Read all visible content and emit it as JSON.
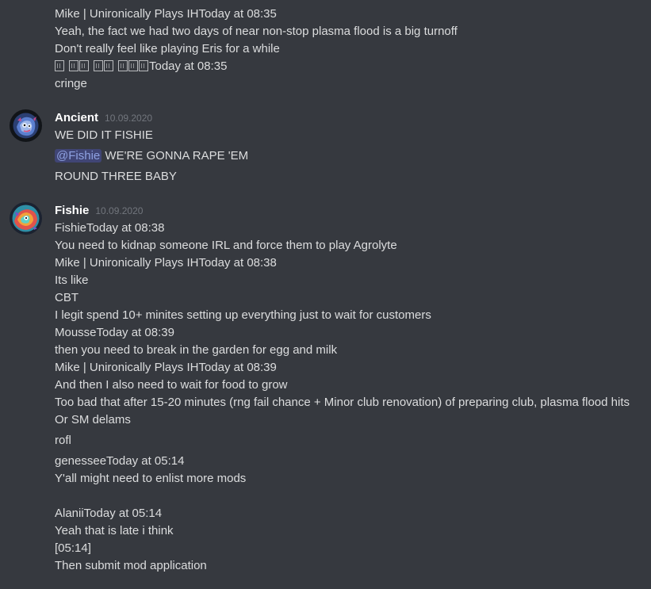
{
  "colors": {
    "background": "#36393f",
    "text": "#dcddde",
    "author": "#ffffff",
    "timestamp": "#72767d",
    "mention": "#8ea1e1"
  },
  "block1": {
    "lines": [
      "Mike | Unironically Plays IHToday at 08:35",
      "Yeah, the fact we had two days of near non-stop plasma flood is a big turnoff",
      "Don't really feel like playing Eris for a while",
      "Today at 08:35",
      "cringe"
    ]
  },
  "ancient": {
    "author": "Ancient",
    "timestamp": "10.09.2020",
    "avatar_icon": "ancient-avatar-icon",
    "line1": "WE DID IT FISHIE",
    "mention": "@Fishie",
    "line2_rest": " WE'RE GONNA RAPE 'EM",
    "line3": "ROUND THREE BABY"
  },
  "fishie": {
    "author": "Fishie",
    "timestamp": "10.09.2020",
    "avatar_icon": "fishie-avatar-icon",
    "lines": [
      "FishieToday at 08:38",
      "You need to kidnap someone IRL and force them to play Agrolyte",
      "Mike | Unironically Plays IHToday at 08:38",
      "Its like",
      "CBT",
      "I legit spend 10+ minites setting up everything just to wait for customers",
      "MousseToday at 08:39",
      "then you need to break in the garden for egg and milk",
      "Mike | Unironically Plays IHToday at 08:39",
      "And then I also need to wait for food to grow",
      "Too bad that after 15-20 minutes (rng fail chance + Minor club renovation) of preparing club, plasma flood hits",
      "Or SM delams",
      "rofl",
      "genesseeToday at 05:14",
      "Y'all might need to enlist more mods",
      "AlaniiToday at 05:14",
      "Yeah that is late i think",
      "[05:14]",
      "Then submit mod application"
    ]
  }
}
